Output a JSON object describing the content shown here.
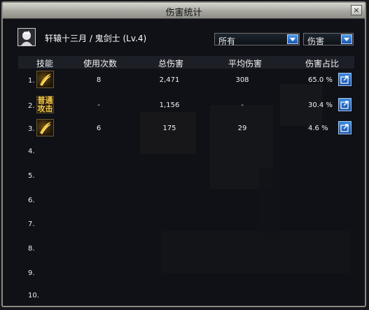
{
  "window": {
    "title": "伤害统计",
    "close_glyph": "×"
  },
  "character": {
    "name": "轩辕十三月 / 鬼剑士 (Lv.4)",
    "avatar": "character-portrait"
  },
  "filters": {
    "scope": "所有",
    "metric": "伤害"
  },
  "columns": {
    "skill": "技能",
    "uses": "使用次数",
    "total": "总伤害",
    "avg": "平均伤害",
    "ratio": "伤害占比"
  },
  "rows": [
    {
      "index": "1.",
      "icon": "slash-skill-icon",
      "uses": "8",
      "total": "2,471",
      "avg": "308",
      "ratio": "65.0 %"
    },
    {
      "index": "2.",
      "icon_text": "普通攻击",
      "uses": "-",
      "total": "1,156",
      "avg": "-",
      "ratio": "30.4 %"
    },
    {
      "index": "3.",
      "icon": "slash-skill-icon",
      "uses": "6",
      "total": "175",
      "avg": "29",
      "ratio": "4.6 %"
    },
    {
      "index": "4."
    },
    {
      "index": "5."
    },
    {
      "index": "6."
    },
    {
      "index": "7."
    },
    {
      "index": "8."
    },
    {
      "index": "9."
    },
    {
      "index": "10."
    }
  ],
  "colors": {
    "accent": "#2a6fd0",
    "title_bar": "#b4b4ae",
    "text": "#f3f3f3",
    "icon_gold": "#f2c94c"
  }
}
